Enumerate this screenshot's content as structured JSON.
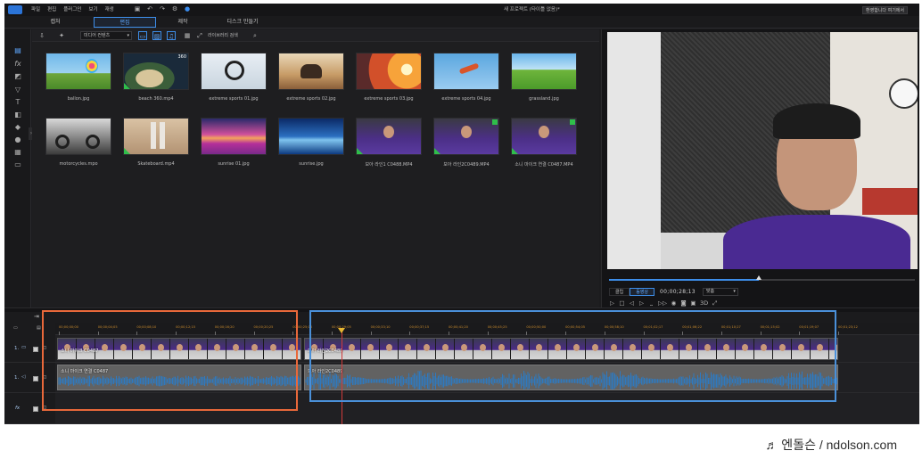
{
  "titlebar": {
    "menus": [
      "파일",
      "편집",
      "플러그인",
      "보기",
      "재생"
    ],
    "document_title": "새 프로젝트 (타이틀 없음)*",
    "welcome": "환영합니다 여기에서"
  },
  "mode_tabs": [
    {
      "label": "캡처",
      "active": false
    },
    {
      "label": "편집",
      "active": true
    },
    {
      "label": "제작",
      "active": false
    },
    {
      "label": "디스크 만들기",
      "active": false
    }
  ],
  "library": {
    "media_filter": "미디어 컨텐츠",
    "search_label": "라이브러리 검색",
    "items": [
      {
        "name": "ballon.jpg",
        "icon": "balloons-photo"
      },
      {
        "name": "beach 360.mp4",
        "icon": "beach-360-video",
        "badge": "360"
      },
      {
        "name": "extreme sports 01.jpg",
        "icon": "bmx-photo"
      },
      {
        "name": "extreme sports 02.jpg",
        "icon": "motocross-photo"
      },
      {
        "name": "extreme sports 03.jpg",
        "icon": "sunset-bike-photo"
      },
      {
        "name": "extreme sports 04.jpg",
        "icon": "skydive-photo"
      },
      {
        "name": "grassland.jpg",
        "icon": "grassland-photo"
      },
      {
        "name": "motorcycles.mpo",
        "icon": "motorcycles-photo"
      },
      {
        "name": "Skateboard.mp4",
        "icon": "skateboard-video"
      },
      {
        "name": "sunrise 01.jpg",
        "icon": "flower-field-photo"
      },
      {
        "name": "sunrise.jpg",
        "icon": "sunrise-photo"
      },
      {
        "name": "보아 라인1 C0488.MP4",
        "icon": "person-video"
      },
      {
        "name": "보아 라인2C0489.MP4",
        "icon": "person-video",
        "checked": true
      },
      {
        "name": "소니 마이크 연결 C0487.MP4",
        "icon": "person-video",
        "checked": true
      }
    ]
  },
  "preview": {
    "tab_clip": "클립",
    "tab_movie": "동영상",
    "timecode": "00;00;28;13",
    "fit": "맞춤",
    "progress": 0.49
  },
  "timeline": {
    "ruler": [
      "00;00;00;00",
      "00;00;04;05",
      "00;00;08;10",
      "00;00;12;15",
      "00;00;16;20",
      "00;00;20;25",
      "00;00;25;00",
      "00;00;29;05",
      "00;00;33;10",
      "00;00;37;15",
      "00;00;41;20",
      "00;00;45;25",
      "00;00;50;00",
      "00;00;54;05",
      "00;00;58;10",
      "00;01;02;17",
      "00;01;06;22",
      "00;01;10;27",
      "00;01;15;02",
      "00;01;19;07",
      "00;01;23;12"
    ],
    "tracks": [
      {
        "label": "1.",
        "type": "video"
      },
      {
        "label": "1.",
        "type": "audio"
      },
      {
        "label": "fx",
        "type": "effect"
      }
    ],
    "video_clips": [
      {
        "label": "소니 마이크 C0487"
      },
      {
        "label": "보아 라인2C0489"
      }
    ],
    "audio_clips": [
      {
        "label": "소니 마이크 연결 C0487"
      },
      {
        "label": "보아 라인2C0489"
      }
    ]
  },
  "watermark": "♬ 엔돌슨 / ndolson.com"
}
